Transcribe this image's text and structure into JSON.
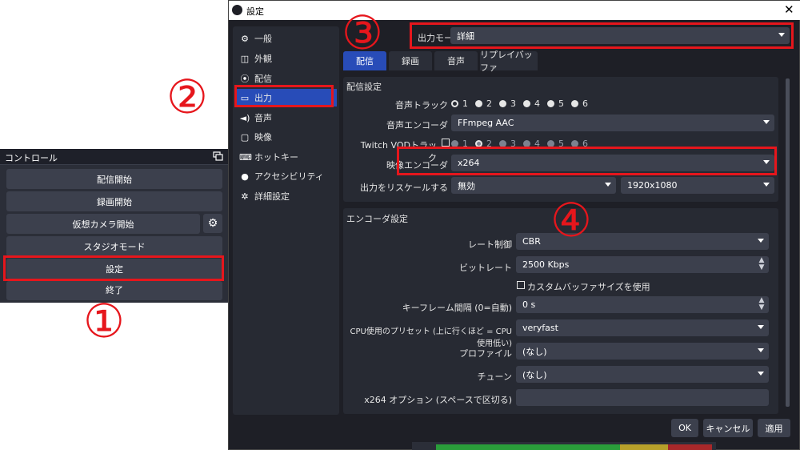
{
  "dock": {
    "title": "コントロール",
    "buttons": [
      "配信開始",
      "録画開始",
      "仮想カメラ開始",
      "スタジオモード",
      "設定",
      "終了"
    ]
  },
  "annotations": [
    "①",
    "②",
    "③",
    "④"
  ],
  "window": {
    "title": "設定",
    "close": "✕"
  },
  "sidebar": {
    "items": [
      {
        "icon": "gear-icon",
        "glyph": "⚙",
        "label": "一般"
      },
      {
        "icon": "appearance-icon",
        "glyph": "◫",
        "label": "外観"
      },
      {
        "icon": "stream-icon",
        "glyph": "📡",
        "label": "配信"
      },
      {
        "icon": "output-icon",
        "glyph": "▭",
        "label": "出力"
      },
      {
        "icon": "speaker-icon",
        "glyph": "🔊",
        "label": "音声"
      },
      {
        "icon": "video-icon",
        "glyph": "▢",
        "label": "映像"
      },
      {
        "icon": "keyboard-icon",
        "glyph": "⌨",
        "label": "ホットキー"
      },
      {
        "icon": "accessibility-icon",
        "glyph": "♿",
        "label": "アクセシビリティ"
      },
      {
        "icon": "wrench-icon",
        "glyph": "✲",
        "label": "詳細設定"
      }
    ]
  },
  "output_mode": {
    "label": "出力モード",
    "value": "詳細"
  },
  "tabs": [
    "配信",
    "録画",
    "音声",
    "リプレイバッファ"
  ],
  "stream_settings": {
    "title": "配信設定",
    "audio_track_label": "音声トラック",
    "audio_tracks": [
      "1",
      "2",
      "3",
      "4",
      "5",
      "6"
    ],
    "audio_encoder_label": "音声エンコーダ",
    "audio_encoder_value": "FFmpeg AAC",
    "twitch_vod_label": "Twitch VODトラック",
    "video_encoder_label": "映像エンコーダ",
    "video_encoder_value": "x264",
    "rescale_label": "出力をリスケールする",
    "rescale_value": "無効",
    "rescale_resolution": "1920x1080"
  },
  "encoder_settings": {
    "title": "エンコーダ設定",
    "rate_control_label": "レート制御",
    "rate_control_value": "CBR",
    "bitrate_label": "ビットレート",
    "bitrate_value": "2500 Kbps",
    "custom_buffer_label": "カスタムバッファサイズを使用",
    "keyframe_label": "キーフレーム間隔 (0=自動)",
    "keyframe_value": "0 s",
    "preset_label": "CPU使用のプリセット (上に行くほど = CPU使用低い)",
    "preset_value": "veryfast",
    "profile_label": "プロファイル",
    "profile_value": "(なし)",
    "tune_label": "チューン",
    "tune_value": "(なし)",
    "x264_options_label": "x264 オプション (スペースで区切る)",
    "x264_options_value": ""
  },
  "buttons": {
    "ok": "OK",
    "cancel": "キャンセル",
    "apply": "適用"
  },
  "colors": {
    "highlight": "#e6161c",
    "accent": "#284cb8",
    "window_bg": "#1e1f26"
  }
}
